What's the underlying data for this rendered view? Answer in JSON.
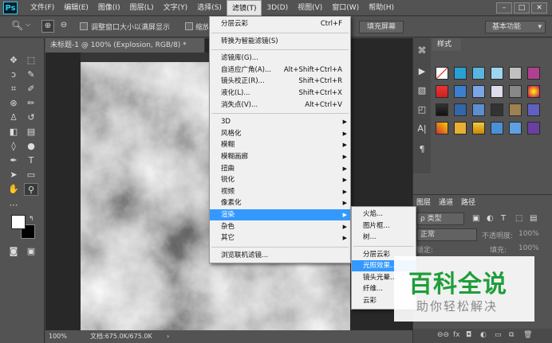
{
  "app": {
    "logo": "Ps"
  },
  "menubar": {
    "items": [
      "文件(F)",
      "编辑(E)",
      "图像(I)",
      "图层(L)",
      "文字(Y)",
      "选择(S)",
      "滤镜(T)",
      "3D(D)",
      "视图(V)",
      "窗口(W)",
      "帮助(H)"
    ],
    "active_index": 6,
    "window_buttons": [
      "–",
      "□",
      "✕"
    ]
  },
  "options": {
    "resize_windows_label": "调整窗口大小以满屏显示",
    "zoom_all_label": "缩放所有",
    "fill_screen_button": "填充屏幕",
    "workspace_value": "基本功能"
  },
  "document": {
    "tab_title": "未标题-1 @ 100% (Explosion, RGB/8) *",
    "zoom": "100%",
    "doc_info": "文档:675.0K/675.0K"
  },
  "filter_menu": {
    "items": [
      {
        "label": "分层云彩",
        "shortcut": "Ctrl+F"
      },
      {
        "sep": true
      },
      {
        "label": "转换为智能滤镜(S)"
      },
      {
        "sep": true
      },
      {
        "label": "滤镜库(G)..."
      },
      {
        "label": "自适应广角(A)...",
        "shortcut": "Alt+Shift+Ctrl+A"
      },
      {
        "label": "镜头校正(R)...",
        "shortcut": "Shift+Ctrl+R"
      },
      {
        "label": "液化(L)...",
        "shortcut": "Shift+Ctrl+X"
      },
      {
        "label": "消失点(V)...",
        "shortcut": "Alt+Ctrl+V"
      },
      {
        "sep": true
      },
      {
        "label": "3D",
        "submenu": true
      },
      {
        "label": "风格化",
        "submenu": true
      },
      {
        "label": "模糊",
        "submenu": true
      },
      {
        "label": "模糊画廊",
        "submenu": true
      },
      {
        "label": "扭曲",
        "submenu": true
      },
      {
        "label": "锐化",
        "submenu": true
      },
      {
        "label": "视频",
        "submenu": true
      },
      {
        "label": "像素化",
        "submenu": true
      },
      {
        "label": "渲染",
        "submenu": true,
        "highlighted": true
      },
      {
        "label": "杂色",
        "submenu": true
      },
      {
        "label": "其它",
        "submenu": true
      },
      {
        "sep": true
      },
      {
        "label": "浏览联机滤镜..."
      }
    ]
  },
  "render_submenu": {
    "items": [
      {
        "label": "火焰..."
      },
      {
        "label": "图片框..."
      },
      {
        "label": "树..."
      },
      {
        "sep": true
      },
      {
        "label": "分层云彩"
      },
      {
        "label": "光照效果...",
        "highlighted": true
      },
      {
        "label": "镜头光晕..."
      },
      {
        "label": "纤维..."
      },
      {
        "label": "云彩"
      }
    ]
  },
  "styles_panel": {
    "tab": "样式"
  },
  "layers_panel": {
    "tabs": [
      "图层",
      "通道",
      "路径"
    ],
    "filter_kind": "ρ 类型",
    "blend_mode": "正常",
    "opacity_label": "不透明度:",
    "opacity_value": "100%",
    "lock_label": "锁定:",
    "fill_label": "填充:",
    "fill_value": "100%"
  },
  "watermark": {
    "title": "百科全说",
    "subtitle": "助你轻松解决"
  },
  "colors": {
    "highlight": "#3399ff",
    "brand_green": "#1e9e3a"
  }
}
